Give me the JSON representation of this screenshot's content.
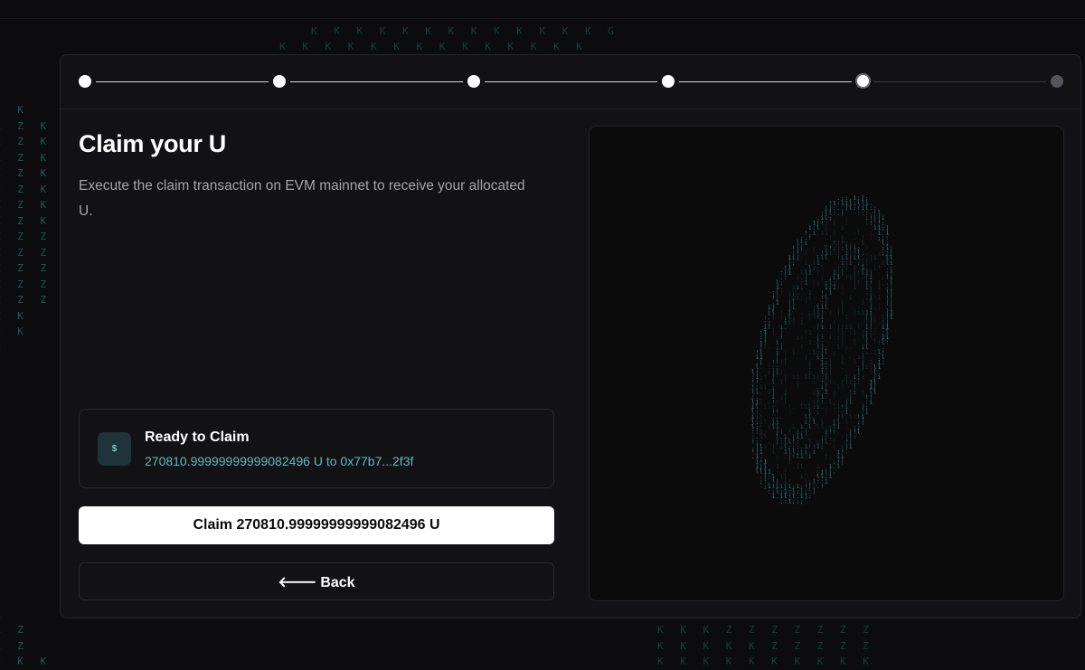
{
  "stepper": {
    "total_steps": 6,
    "current_step_index": 4
  },
  "claim": {
    "title": "Claim your U",
    "description": "Execute the claim transaction on EVM mainnet to receive your allocated U.",
    "status": {
      "icon_glyph": "$",
      "title": "Ready to Claim",
      "detail": "270810.99999999999082496 U to 0x77b7...2f3f"
    },
    "claim_button_label": "Claim 270810.99999999999082496 U",
    "back_button_arrow": "🡐",
    "back_button_label": "Back"
  },
  "background_glyphs": {
    "top_row_1": "K K K K K K K K K K K K K G",
    "top_row_2": "K K K K K K K K K K K K K K",
    "left_column": "  K\nZ Z K\nZ Z K\nZ Z K\nZ Z K\nZ Z K\nZ Z K\nZ Z K\nZ Z Z\nZ Z Z\nZ Z Z\nZ Z Z\nK Z Z\nK K\nK K\nK",
    "left_bottom": "\n\n\nZ\nZ Z\nZ Z\nK K K",
    "bottom_row_1": "K K K Z Z Z Z Z Z Z",
    "bottom_row_2": "K K K K K Z Z Z Z Z",
    "bottom_row_3": "K K K K K K K K K K"
  },
  "colors": {
    "background": "#0c0c0e",
    "card": "#121214",
    "accent_teal": "#5fb9c2",
    "glyph_teal": "#1e5a58",
    "button_primary": "#ffffff"
  },
  "icons": {
    "status": "dollar-icon",
    "back": "arrow-left-icon",
    "visual": "ascii-coin-graphic"
  }
}
